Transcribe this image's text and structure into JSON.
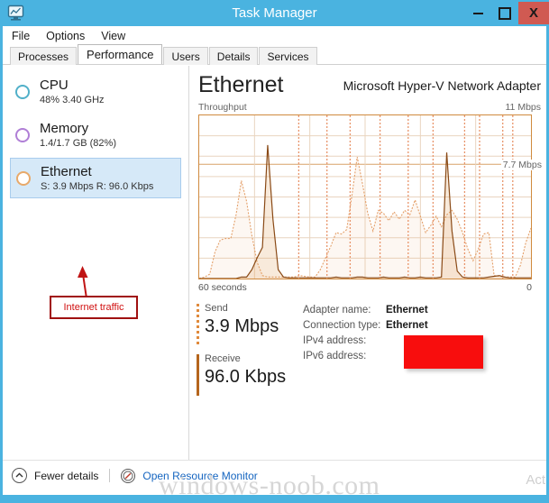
{
  "window": {
    "title": "Task Manager",
    "icon": "task-manager-icon",
    "buttons": {
      "minimize": "–",
      "maximize": "□",
      "close": "X"
    }
  },
  "menu": {
    "items": [
      "File",
      "Options",
      "View"
    ]
  },
  "tabs": {
    "items": [
      "Processes",
      "Performance",
      "Users",
      "Details",
      "Services"
    ],
    "active": "Performance"
  },
  "sidebar": {
    "items": [
      {
        "name": "CPU",
        "sub": "48%  3.40 GHz",
        "color": "#51b0c9",
        "selected": false
      },
      {
        "name": "Memory",
        "sub": "1.4/1.7 GB (82%)",
        "color": "#b07fd6",
        "selected": false
      },
      {
        "name": "Ethernet",
        "sub": "S: 3.9 Mbps R: 96.0 Kbps",
        "color": "#e8a96a",
        "selected": true
      }
    ],
    "annotation": {
      "text": "Internet traffic",
      "border_color": "#a01010",
      "text_color": "#d01010"
    }
  },
  "main": {
    "title": "Ethernet",
    "subtitle": "Microsoft Hyper-V Network Adapter",
    "graph_label_left": "Throughput",
    "graph_label_right": "11 Mbps",
    "axis_left": "60 seconds",
    "axis_right": "0",
    "marker": "7.7 Mbps",
    "stats": {
      "send_label": "Send",
      "send_value": "3.9 Mbps",
      "receive_label": "Receive",
      "receive_value": "96.0 Kbps"
    },
    "info": [
      {
        "key": "Adapter name:",
        "value": "Ethernet"
      },
      {
        "key": "Connection type:",
        "value": "Ethernet"
      },
      {
        "key": "IPv4 address:",
        "value": ""
      },
      {
        "key": "IPv6 address:",
        "value": ""
      }
    ],
    "redaction_color": "#f80d0d"
  },
  "footer": {
    "fewer_details": "Fewer details",
    "resource_monitor": "Open Resource Monitor",
    "watermark": "windows-noob.com",
    "activate": "Act"
  },
  "chart_data": {
    "type": "line",
    "title": "Throughput",
    "xlabel": "",
    "ylabel": "Mbps",
    "ylim": [
      0,
      11
    ],
    "xlim": [
      60,
      0
    ],
    "grid": true,
    "legend_position": "none",
    "annotations": [
      "11 Mbps",
      "7.7 Mbps",
      "60 seconds",
      "0"
    ],
    "gridlines_y": [
      1.375,
      2.75,
      4.125,
      5.5,
      6.875,
      7.7,
      8.25,
      9.625
    ],
    "series": [
      {
        "name": "Send",
        "style": "dashed",
        "color": "#e4a06a",
        "values": [
          0,
          0.1,
          0.3,
          1.8,
          2.6,
          2.7,
          2.7,
          4.3,
          6.6,
          5.2,
          2.9,
          1.1,
          0.2,
          0.1,
          0.1,
          0.1,
          0.1,
          0.1,
          0.1,
          0.2,
          0.15,
          0.1,
          0.1,
          0.6,
          1.4,
          2.2,
          3.1,
          3.0,
          3.3,
          5.6,
          8.2,
          6.4,
          4.4,
          3.2,
          4.6,
          4.4,
          3.9,
          4.5,
          4.0,
          4.6,
          4.3,
          5.3,
          4.2,
          3.1,
          3.6,
          4.2,
          3.5,
          4.3,
          4.6,
          4.0,
          3.1,
          2.0,
          1.2,
          2.0,
          3.0,
          3.1,
          0.2,
          0.15,
          0.1,
          0.1,
          0.1,
          0.9,
          2.4,
          3.4
        ]
      },
      {
        "name": "Receive",
        "style": "solid",
        "color": "#8a4a16",
        "values": [
          0,
          0,
          0,
          0,
          0,
          0,
          0,
          0,
          0.1,
          0.1,
          0.6,
          1.4,
          2.1,
          9.0,
          4.0,
          0.6,
          0.1,
          0.05,
          0.05,
          0.05,
          0.05,
          0.05,
          0.05,
          0.05,
          0.05,
          0.05,
          0.1,
          0.05,
          0.05,
          0.05,
          0.1,
          0.1,
          0.05,
          0.05,
          0.05,
          0.1,
          0.05,
          0.05,
          0.05,
          0.1,
          0.05,
          0.05,
          0.1,
          0.05,
          0.05,
          0.05,
          0.1,
          8.5,
          3.2,
          0.5,
          0.1,
          0.05,
          0.05,
          0.05,
          0.05,
          0.1,
          0.15,
          0.2,
          0.1,
          0.05,
          0.05,
          0.05,
          0.05,
          0.05
        ]
      }
    ]
  }
}
